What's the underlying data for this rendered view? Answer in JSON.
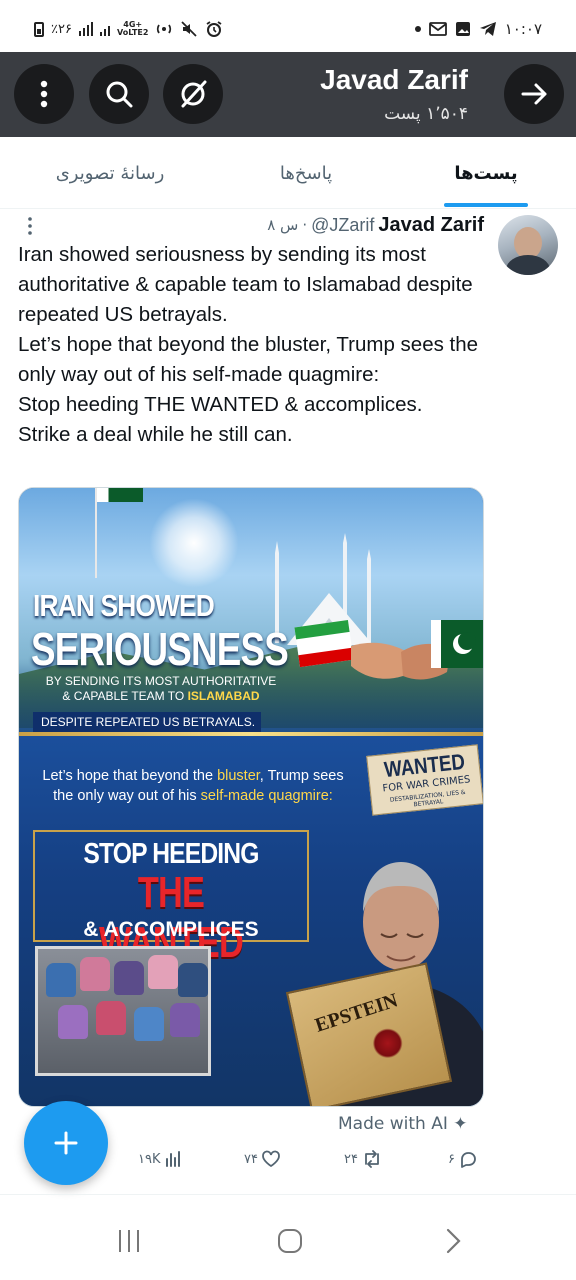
{
  "status_bar": {
    "battery": "٪۲۶",
    "network": "4G+\nVoLTE2",
    "time": "۱۰:۰۷"
  },
  "header": {
    "name": "Javad Zarif",
    "post_count": "۱٬۵۰۴ پست",
    "back_icon": "arrow-right-icon",
    "search_icon": "search-icon",
    "menu_icon": "more-vertical-icon",
    "grok_icon": "grok-icon"
  },
  "tabs": {
    "posts": "پست‌ها",
    "replies": "پاسخ‌ها",
    "media": "رسانهٔ تصویری"
  },
  "post": {
    "author_name": "Javad Zarif",
    "handle": "@JZarif",
    "separator": "·",
    "time": "۸ س",
    "text": "Iran showed seriousness by sending its most authoritative & capable team to Islamabad despite repeated US betrayals.\nLet’s hope that beyond the bluster, Trump sees the only way out of his self-made quagmire:\nStop heeding THE WANTED & accomplices.\nStrike a deal while he still can.",
    "image": {
      "headline1": "IRAN SHOWED",
      "headline2": "SERIOUSNESS",
      "sending_prefix": "BY SENDING ITS MOST AUTHORITATIVE & CAPABLE TEAM TO ",
      "sending_city": "ISLAMABAD",
      "despite": "DESPITE REPEATED US BETRAYALS.",
      "hope_a": "Let’s hope that beyond the ",
      "hope_bluster": "bluster",
      "hope_b": ", Trump sees the only way out of his ",
      "hope_quagmire": "self-made quagmire:",
      "stop": "STOP HEEDING",
      "wanted": "THE WANTED",
      "accomplices": "& ACCOMPLICES",
      "poster_title": "WANTED",
      "poster_sub": "FOR WAR CRIMES",
      "poster_small": "DESTABILIZATION, LIES & BETRAYAL",
      "folder_label": "EPSTEIN"
    },
    "ai_label": "Made with AI",
    "stats": {
      "views": "۱۹K",
      "likes": "۷۴",
      "reposts": "۲۴",
      "replies": "۶"
    }
  },
  "colors": {
    "accent": "#1d9bf0",
    "header_bg": "#3a3d42",
    "text_primary": "#0f1419",
    "text_secondary": "#536471"
  }
}
